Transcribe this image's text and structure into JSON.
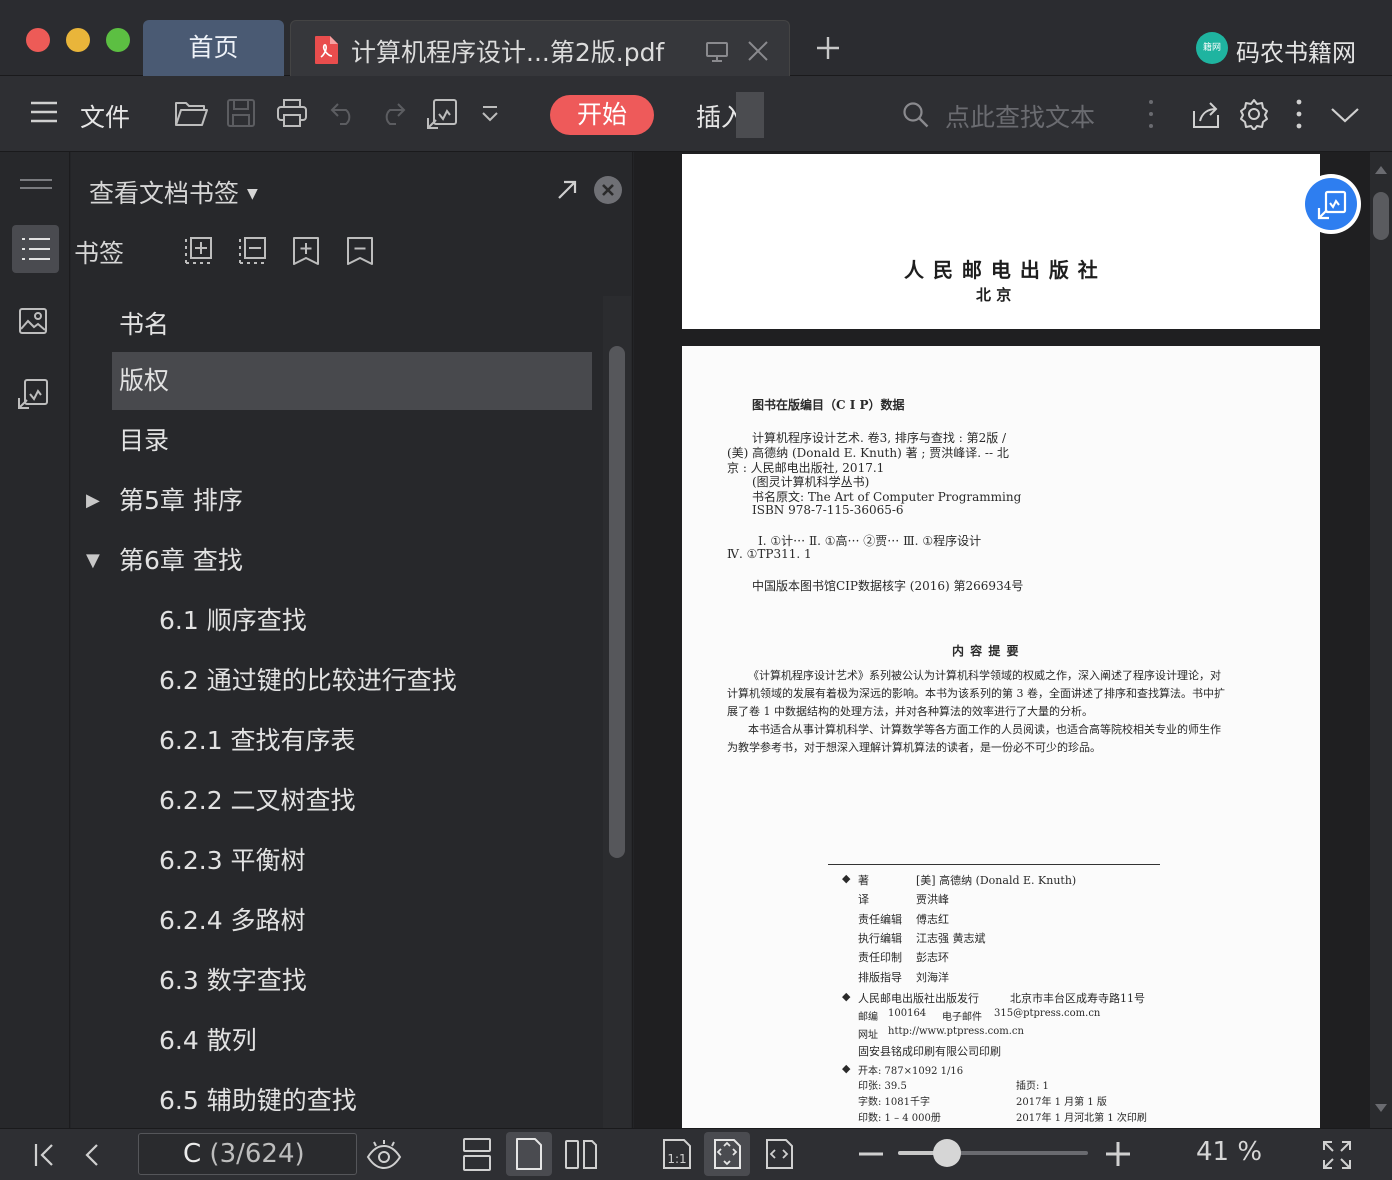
{
  "tabs": {
    "home_label": "首页",
    "doc_title": "计算机程序设计...第2版.pdf",
    "brand": "码农书籍网",
    "brand_badge": "籍网"
  },
  "toolbar": {
    "file_label": "文件",
    "start_label": "开始",
    "insert_label": "插入",
    "search_placeholder": "点此查找文本"
  },
  "panel": {
    "header_title": "查看文档书签",
    "bookmark_label": "书签",
    "items": [
      {
        "label": "书名",
        "level": 1,
        "selected": false
      },
      {
        "label": "版权",
        "level": 1,
        "selected": true
      },
      {
        "label": "目录",
        "level": 1,
        "selected": false
      },
      {
        "label": "第5章  排序",
        "level": 1,
        "expander": "collapsed"
      },
      {
        "label": "第6章  查找",
        "level": 1,
        "expander": "expanded"
      },
      {
        "label": "6.1  顺序查找",
        "level": 2
      },
      {
        "label": "6.2  通过键的比较进行查找",
        "level": 2
      },
      {
        "label": "6.2.1  查找有序表",
        "level": 2
      },
      {
        "label": "6.2.2  二叉树查找",
        "level": 2
      },
      {
        "label": "6.2.3  平衡树",
        "level": 2
      },
      {
        "label": "6.2.4  多路树",
        "level": 2
      },
      {
        "label": "6.3  数字查找",
        "level": 2
      },
      {
        "label": "6.4  散列",
        "level": 2
      },
      {
        "label": "6.5  辅助键的查找",
        "level": 2
      }
    ]
  },
  "page1": {
    "publisher": "人 民 邮 电 出 版 社",
    "city": "北  京"
  },
  "page2": {
    "cip_title": "图书在版编目（C I P）数据",
    "cip_lines": [
      "计算机程序设计艺术. 卷3, 排序与查找 : 第2版 /",
      "(美) 高德纳 (Donald E. Knuth) 著 ; 贾洪峰译. -- 北",
      "京 : 人民邮电出版社, 2017.1",
      "(图灵计算机科学丛书)",
      "书名原文: The Art of Computer Programming",
      "ISBN 978-7-115-36065-6"
    ],
    "cls_line1": "Ⅰ. ①计⋯  Ⅱ. ①高⋯  ②贾⋯  Ⅲ. ①程序设计",
    "cls_line2": "Ⅳ. ①TP311. 1",
    "cip_core": "中国版本图书馆CIP数据核字 (2016) 第266934号",
    "summary_title": "内 容 提 要",
    "summary_lines": [
      "《计算机程序设计艺术》系列被公认为计算机科学领域的权威之作，深入阐述了程序设计理论，对",
      "计算机领域的发展有着极为深远的影响。本书为该系列的第 3 卷，全面讲述了排序和查找算法。书中扩",
      "展了卷 1 中数据结构的处理方法，并对各种算法的效率进行了大量的分析。",
      "本书适合从事计算机科学、计算数学等各方面工作的人员阅读，也适合高等院校相关专业的师生作",
      "为教学参考书，对于想深入理解计算机算法的读者，是一份必不可少的珍品。"
    ],
    "credits": [
      {
        "k": "著",
        "v": "[美] 高德纳 (Donald E. Knuth)"
      },
      {
        "k": "译",
        "v": "贾洪峰"
      },
      {
        "k": "责任编辑",
        "v": "傅志红"
      },
      {
        "k": "执行编辑",
        "v": "江志强 黄志斌"
      },
      {
        "k": "责任印制",
        "v": "彭志环"
      },
      {
        "k": "排版指导",
        "v": "刘海洋"
      }
    ],
    "publisher_line": "人民邮电出版社出版发行",
    "address": "北京市丰台区成寿寺路11号",
    "postcode_label": "邮编",
    "postcode": "100164",
    "email_label": "电子邮件",
    "email": "315@ptpress.com.cn",
    "web_label": "网址",
    "web": "http://www.ptpress.com.cn",
    "printer": "固安县铭成印刷有限公司印刷",
    "format": "开本: 787×1092   1/16",
    "sheets": "印张: 39.5",
    "plates": "插页: 1",
    "words": "字数: 1081千字",
    "edition": "2017年 1 月第 1 版",
    "copies": "印数: 1 – 4 000册",
    "print_date": "2017年 1 月河北第 1 次印刷"
  },
  "status": {
    "page_current": "C",
    "page_info": "(3/624)",
    "zoom": "41 %",
    "zoom_fraction": 0.41
  }
}
